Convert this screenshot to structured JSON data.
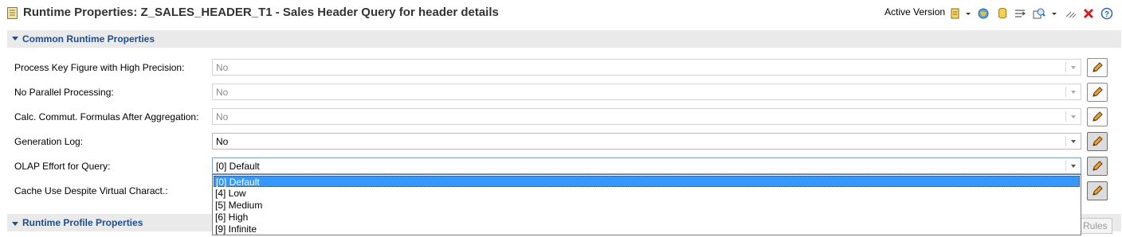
{
  "header": {
    "title": "Runtime Properties: Z_SALES_HEADER_T1 - Sales Header Query for header details",
    "active_version_label": "Active Version",
    "toolbar_icons": [
      "version-doc-icon",
      "dropdown-arrow-icon",
      "globe-icon",
      "database-icon",
      "text-wrap-icon",
      "search-query-icon",
      "menu-arrow-icon",
      "compare-icon",
      "close-red-icon",
      "help-icon"
    ]
  },
  "sections": {
    "common": {
      "title": "Common Runtime Properties"
    },
    "profile": {
      "title": "Runtime Profile Properties"
    }
  },
  "properties": [
    {
      "label": "Process Key Figure with High Precision:",
      "value": "No",
      "enabled": false
    },
    {
      "label": "No Parallel Processing:",
      "value": "No",
      "enabled": false
    },
    {
      "label": "Calc. Commut. Formulas After Aggregation:",
      "value": "No",
      "enabled": false
    },
    {
      "label": "Generation Log:",
      "value": "No",
      "enabled": true
    },
    {
      "label": "OLAP Effort for Query:",
      "value": "[0] Default",
      "enabled": true
    },
    {
      "label": "Cache Use Despite Virtual Charact.:",
      "value": "",
      "enabled": true
    }
  ],
  "dropdown": {
    "options": [
      "[0] Default",
      "[4] Low",
      "[5] Medium",
      "[6] High",
      "[9] Infinite"
    ],
    "selected": "[0] Default"
  },
  "rules_button_label": "Rules",
  "colors": {
    "section_title": "#1f4e8c",
    "section_bg": "#eaeaea",
    "selection": "#3399ff"
  }
}
